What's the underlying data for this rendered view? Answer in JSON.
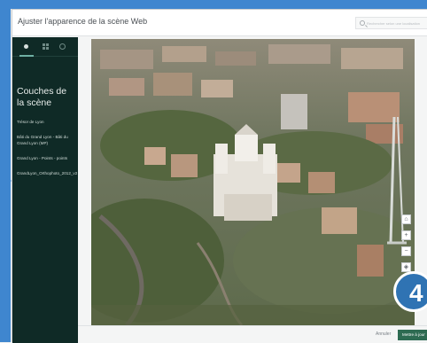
{
  "window": {
    "title": "Ajuster l'apparence de la scène Web",
    "search_placeholder": "Rechercher selon une localisation"
  },
  "sidebar": {
    "tabs": [
      {
        "icon": "layers-icon",
        "active": true
      },
      {
        "icon": "grid-icon",
        "active": false
      },
      {
        "icon": "info-icon",
        "active": false
      }
    ],
    "title": "Couches de la scène",
    "layers": [
      "Trésor de Lyon",
      "Bâti du Grand Lyon - Bâti du Grand Lyon (MP)",
      "Grand Lyon - Points - points",
      "GrandLyon_Orthophoto_2012_v2"
    ]
  },
  "scene": {
    "navigation": [
      "home-icon",
      "zoom-in-icon",
      "zoom-out-icon",
      "compass-icon"
    ]
  },
  "footer": {
    "cancel_label": "Annuler",
    "apply_label": "Mettre à jour"
  },
  "callout": {
    "step": "4"
  },
  "colors": {
    "sidebar_bg": "#0f2a26",
    "accent_green": "#2e6b52",
    "callout_blue": "#2f73b3",
    "frame_blue": "#3f86cf"
  }
}
